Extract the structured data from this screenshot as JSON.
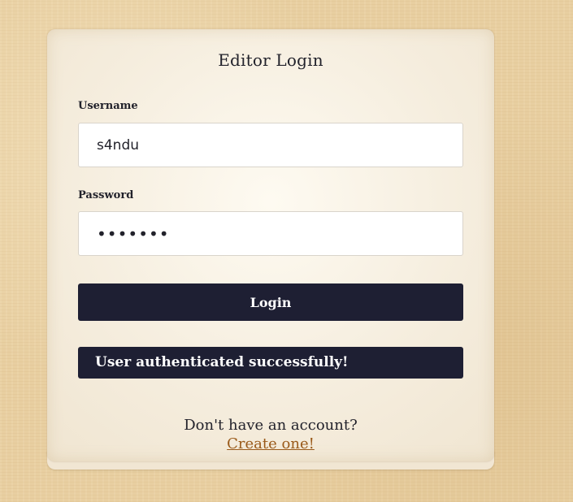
{
  "login_form": {
    "title": "Editor Login",
    "username_label": "Username",
    "username_value": "s4ndu",
    "password_label": "Password",
    "password_value": "sandbox",
    "login_button": "Login",
    "status_message": "User authenticated successfully!",
    "signup_prompt": "Don't have an account?",
    "signup_link": "Create one!"
  },
  "colors": {
    "button_background": "#1e1f33",
    "link": "#9a5a1a",
    "page_background": "#e8cfa1"
  }
}
